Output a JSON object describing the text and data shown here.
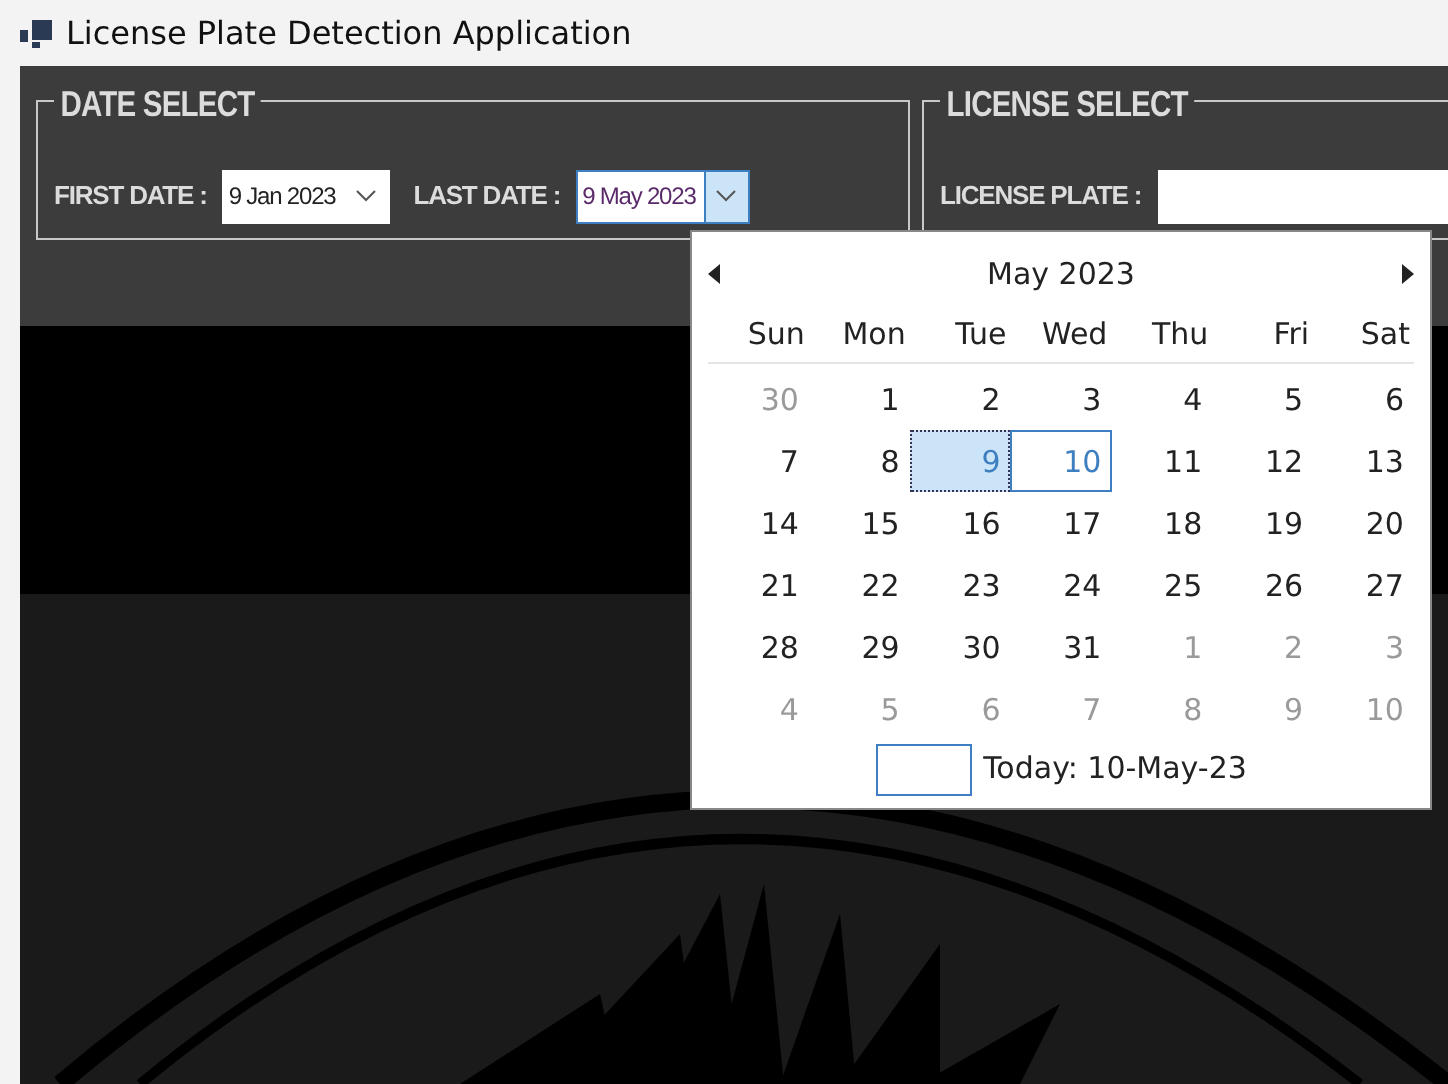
{
  "window": {
    "title": "License Plate Detection Application"
  },
  "date_select": {
    "title": "DATE SELECT",
    "first_date": {
      "label": "FIRST DATE :",
      "value": "9 Jan 2023",
      "focused": false
    },
    "last_date": {
      "label": "LAST DATE :",
      "value": "9 May 2023",
      "focused": true
    }
  },
  "license_select": {
    "title": "LICENSE SELECT",
    "plate_label": "LICENSE PLATE :"
  },
  "calendar": {
    "month": "May 2023",
    "weekdays": [
      "Sun",
      "Mon",
      "Tue",
      "Wed",
      "Thu",
      "Fri",
      "Sat"
    ],
    "weeks": [
      [
        {
          "label": "30",
          "other_month": true,
          "selected": false,
          "today": false
        },
        {
          "label": "1",
          "other_month": false,
          "selected": false,
          "today": false
        },
        {
          "label": "2",
          "other_month": false,
          "selected": false,
          "today": false
        },
        {
          "label": "3",
          "other_month": false,
          "selected": false,
          "today": false
        },
        {
          "label": "4",
          "other_month": false,
          "selected": false,
          "today": false
        },
        {
          "label": "5",
          "other_month": false,
          "selected": false,
          "today": false
        },
        {
          "label": "6",
          "other_month": false,
          "selected": false,
          "today": false
        }
      ],
      [
        {
          "label": "7",
          "other_month": false,
          "selected": false,
          "today": false
        },
        {
          "label": "8",
          "other_month": false,
          "selected": false,
          "today": false
        },
        {
          "label": "9",
          "other_month": false,
          "selected": true,
          "today": false
        },
        {
          "label": "10",
          "other_month": false,
          "selected": false,
          "today": true
        },
        {
          "label": "11",
          "other_month": false,
          "selected": false,
          "today": false
        },
        {
          "label": "12",
          "other_month": false,
          "selected": false,
          "today": false
        },
        {
          "label": "13",
          "other_month": false,
          "selected": false,
          "today": false
        }
      ],
      [
        {
          "label": "14",
          "other_month": false,
          "selected": false,
          "today": false
        },
        {
          "label": "15",
          "other_month": false,
          "selected": false,
          "today": false
        },
        {
          "label": "16",
          "other_month": false,
          "selected": false,
          "today": false
        },
        {
          "label": "17",
          "other_month": false,
          "selected": false,
          "today": false
        },
        {
          "label": "18",
          "other_month": false,
          "selected": false,
          "today": false
        },
        {
          "label": "19",
          "other_month": false,
          "selected": false,
          "today": false
        },
        {
          "label": "20",
          "other_month": false,
          "selected": false,
          "today": false
        }
      ],
      [
        {
          "label": "21",
          "other_month": false,
          "selected": false,
          "today": false
        },
        {
          "label": "22",
          "other_month": false,
          "selected": false,
          "today": false
        },
        {
          "label": "23",
          "other_month": false,
          "selected": false,
          "today": false
        },
        {
          "label": "24",
          "other_month": false,
          "selected": false,
          "today": false
        },
        {
          "label": "25",
          "other_month": false,
          "selected": false,
          "today": false
        },
        {
          "label": "26",
          "other_month": false,
          "selected": false,
          "today": false
        },
        {
          "label": "27",
          "other_month": false,
          "selected": false,
          "today": false
        }
      ],
      [
        {
          "label": "28",
          "other_month": false,
          "selected": false,
          "today": false
        },
        {
          "label": "29",
          "other_month": false,
          "selected": false,
          "today": false
        },
        {
          "label": "30",
          "other_month": false,
          "selected": false,
          "today": false
        },
        {
          "label": "31",
          "other_month": false,
          "selected": false,
          "today": false
        },
        {
          "label": "1",
          "other_month": true,
          "selected": false,
          "today": false
        },
        {
          "label": "2",
          "other_month": true,
          "selected": false,
          "today": false
        },
        {
          "label": "3",
          "other_month": true,
          "selected": false,
          "today": false
        }
      ],
      [
        {
          "label": "4",
          "other_month": true,
          "selected": false,
          "today": false
        },
        {
          "label": "5",
          "other_month": true,
          "selected": false,
          "today": false
        },
        {
          "label": "6",
          "other_month": true,
          "selected": false,
          "today": false
        },
        {
          "label": "7",
          "other_month": true,
          "selected": false,
          "today": false
        },
        {
          "label": "8",
          "other_month": true,
          "selected": false,
          "today": false
        },
        {
          "label": "9",
          "other_month": true,
          "selected": false,
          "today": false
        },
        {
          "label": "10",
          "other_month": true,
          "selected": false,
          "today": false
        }
      ]
    ],
    "today_label": "Today: 10-May-23"
  }
}
